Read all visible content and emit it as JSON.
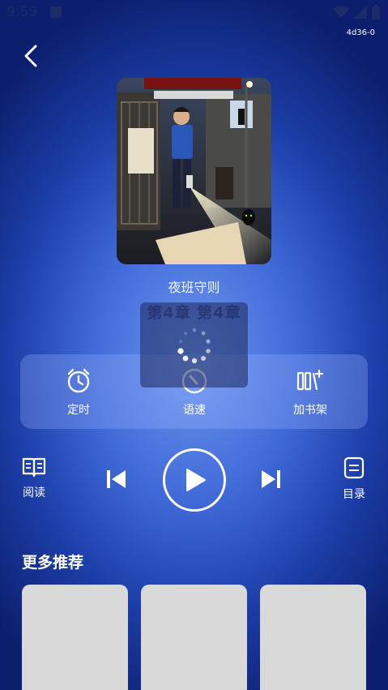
{
  "status": {
    "time": "9:59"
  },
  "build_tag": "4d36-0",
  "book": {
    "title": "夜班守则",
    "chapter": "第4章  第4章"
  },
  "controls": {
    "timer_label": "定时",
    "speed_label": "语速",
    "shelf_label": "加书架"
  },
  "player": {
    "read_label": "阅读",
    "toc_label": "目录"
  },
  "recommend": {
    "title": "更多推荐",
    "cards": 3
  },
  "icons": [
    "back-icon",
    "alarm-clock-icon",
    "speed-gauge-icon",
    "add-to-shelf-icon",
    "book-open-icon",
    "skip-previous-icon",
    "play-icon",
    "skip-next-icon",
    "list-icon",
    "loading-spinner-icon"
  ],
  "colors": {
    "accent": "#3f69d8",
    "bg_dark": "#0c1f6e",
    "card": "#d9d9d9"
  }
}
